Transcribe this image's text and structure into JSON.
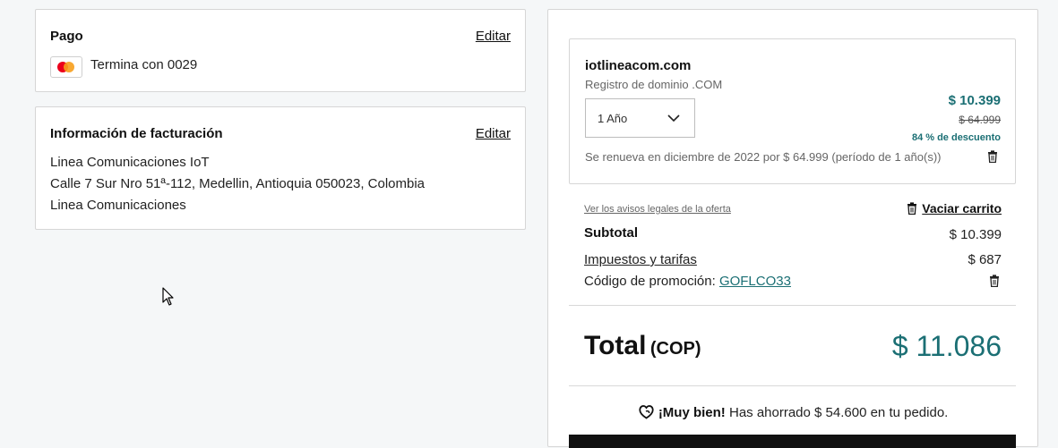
{
  "payment": {
    "title": "Pago",
    "edit_label": "Editar",
    "card_text": "Termina con 0029"
  },
  "billing": {
    "title": "Información de facturación",
    "edit_label": "Editar",
    "lines": [
      "Linea Comunicaciones IoT",
      "Calle 7 Sur Nro 51ª-112, Medellin, Antioquia 050023, Colombia",
      "Linea Comunicaciones"
    ]
  },
  "cart": {
    "item": {
      "name": "iotlineacom.com",
      "subtitle": "Registro de dominio .COM",
      "term": "1 Año",
      "price": "$ 10.399",
      "old_price": "$ 64.999",
      "discount": "84 % de descuento",
      "renew_note": "Se renueva en diciembre de 2022 por $ 64.999 (período de 1 año(s))"
    },
    "legal_link": "Ver los avisos legales de la oferta",
    "empty_cart": "Vaciar carrito",
    "subtotal_label": "Subtotal",
    "subtotal_value": "$ 10.399",
    "taxes_label": "Impuestos y tarifas",
    "taxes_value": "$ 687",
    "promo_label": "Código de promoción:",
    "promo_code": "GOFLCO33",
    "total_label": "Total",
    "total_currency": "(COP)",
    "total_value": "$ 11.086",
    "savings_bold": "¡Muy bien!",
    "savings_text": "Has ahorrado $ 54.600 en tu pedido."
  },
  "colors": {
    "accent": "#1b6f74"
  }
}
